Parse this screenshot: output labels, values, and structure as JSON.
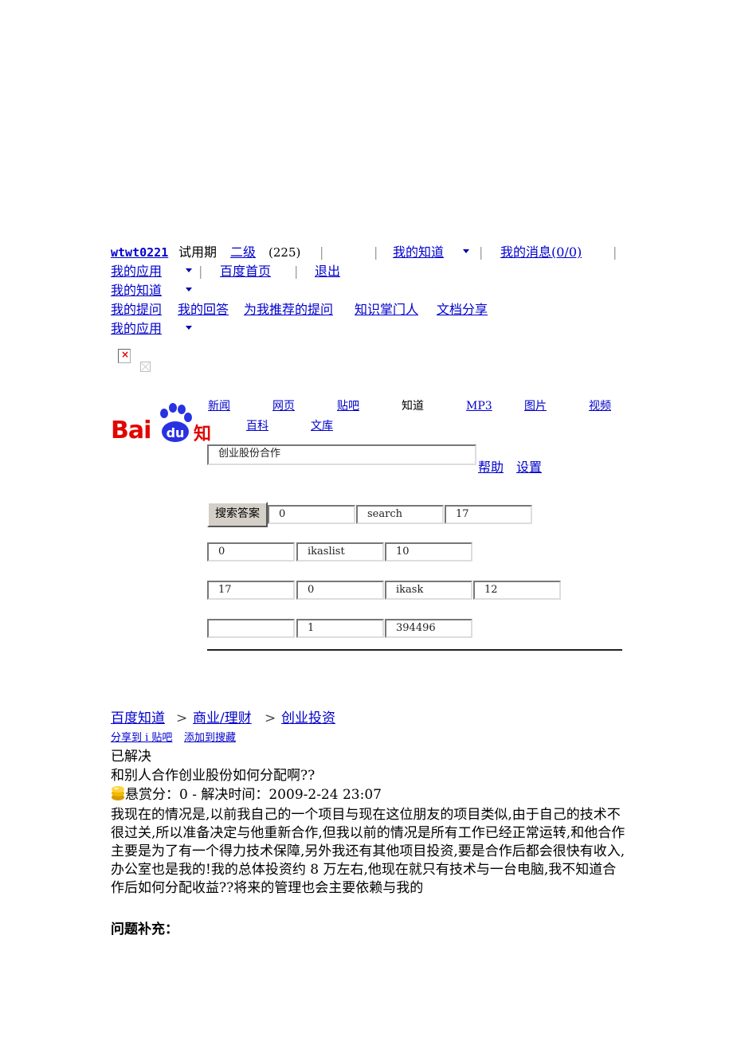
{
  "userbar": {
    "username": "wtwt0221",
    "status": "试用期",
    "level": "二级",
    "score": "(225)",
    "my_zhidao": "我的知道",
    "my_messages": "我的消息(0/0)",
    "my_apps": "我的应用",
    "baidu_home": "百度首页",
    "logout": "退出"
  },
  "my_zhidao_menu": {
    "title": "我的知道",
    "items": [
      "我的提问",
      "我的回答",
      "为我推荐的提问",
      "知识掌门人",
      "文档分享"
    ]
  },
  "my_apps_menu": {
    "title": "我的应用"
  },
  "logo": {
    "text": "Bai",
    "paw_text": "du",
    "suffix": "知"
  },
  "search_nav": {
    "row1": [
      "新闻",
      "网页",
      "贴吧",
      "知道",
      "MP3",
      "图片",
      "视频"
    ],
    "row2": [
      "百科",
      "文库"
    ],
    "active": "知道"
  },
  "search": {
    "query": "创业股份合作",
    "help": "帮助",
    "settings": "设置",
    "submit": "搜索答案"
  },
  "hidden_fields": {
    "row1": [
      "0",
      "search",
      "17"
    ],
    "row2": [
      "0",
      "ikaslist",
      "10"
    ],
    "row3": [
      "17",
      "0",
      "ikask",
      "12"
    ],
    "row4": [
      "",
      "1",
      "394496"
    ]
  },
  "breadcrumb": {
    "items": [
      "百度知道",
      "商业/理财",
      "创业投资"
    ],
    "separator": ">"
  },
  "share": {
    "share_tieba": "分享到 i 贴吧",
    "add_favorite": "添加到搜藏"
  },
  "question": {
    "status": "已解决",
    "title": "和别人合作创业股份如何分配啊??",
    "reward_label": "悬赏分：0 - 解决时间：2009-2-24 23:07",
    "body": "我现在的情况是,以前我自己的一个项目与现在这位朋友的项目类似,由于自己的技术不很过关,所以准备决定与他重新合作,但我以前的情况是所有工作已经正常运转,和他合作主要是为了有一个得力技术保障,另外我还有其他项目投资,要是合作后都会很快有收入,办公室也是我的!我的总体投资约 8 万左右,他现在就只有技术与一台电脑,我不知道合作后如何分配收益??将来的管理也会主要依赖与我的",
    "supplement_label": "问题补充："
  }
}
